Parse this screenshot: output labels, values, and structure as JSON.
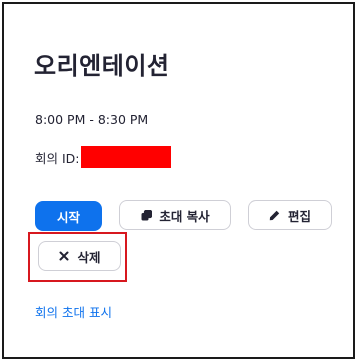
{
  "meeting": {
    "title": "오리엔테이션",
    "time_range": "8:00 PM - 8:30 PM",
    "id_label": "회의 ID:"
  },
  "actions": {
    "start_label": "시작",
    "copy_invite_label": "초대 복사",
    "edit_label": "편집",
    "delete_label": "삭제"
  },
  "footer": {
    "show_invite_link": "회의 초대 표시"
  },
  "icons": {
    "copy": "copy-icon",
    "edit": "pencil-icon",
    "delete": "close-icon"
  },
  "colors": {
    "primary": "#0e72ed",
    "link": "#0e72ed",
    "redaction": "#ff0000",
    "highlight": "#d7181f",
    "text": "#232333"
  }
}
